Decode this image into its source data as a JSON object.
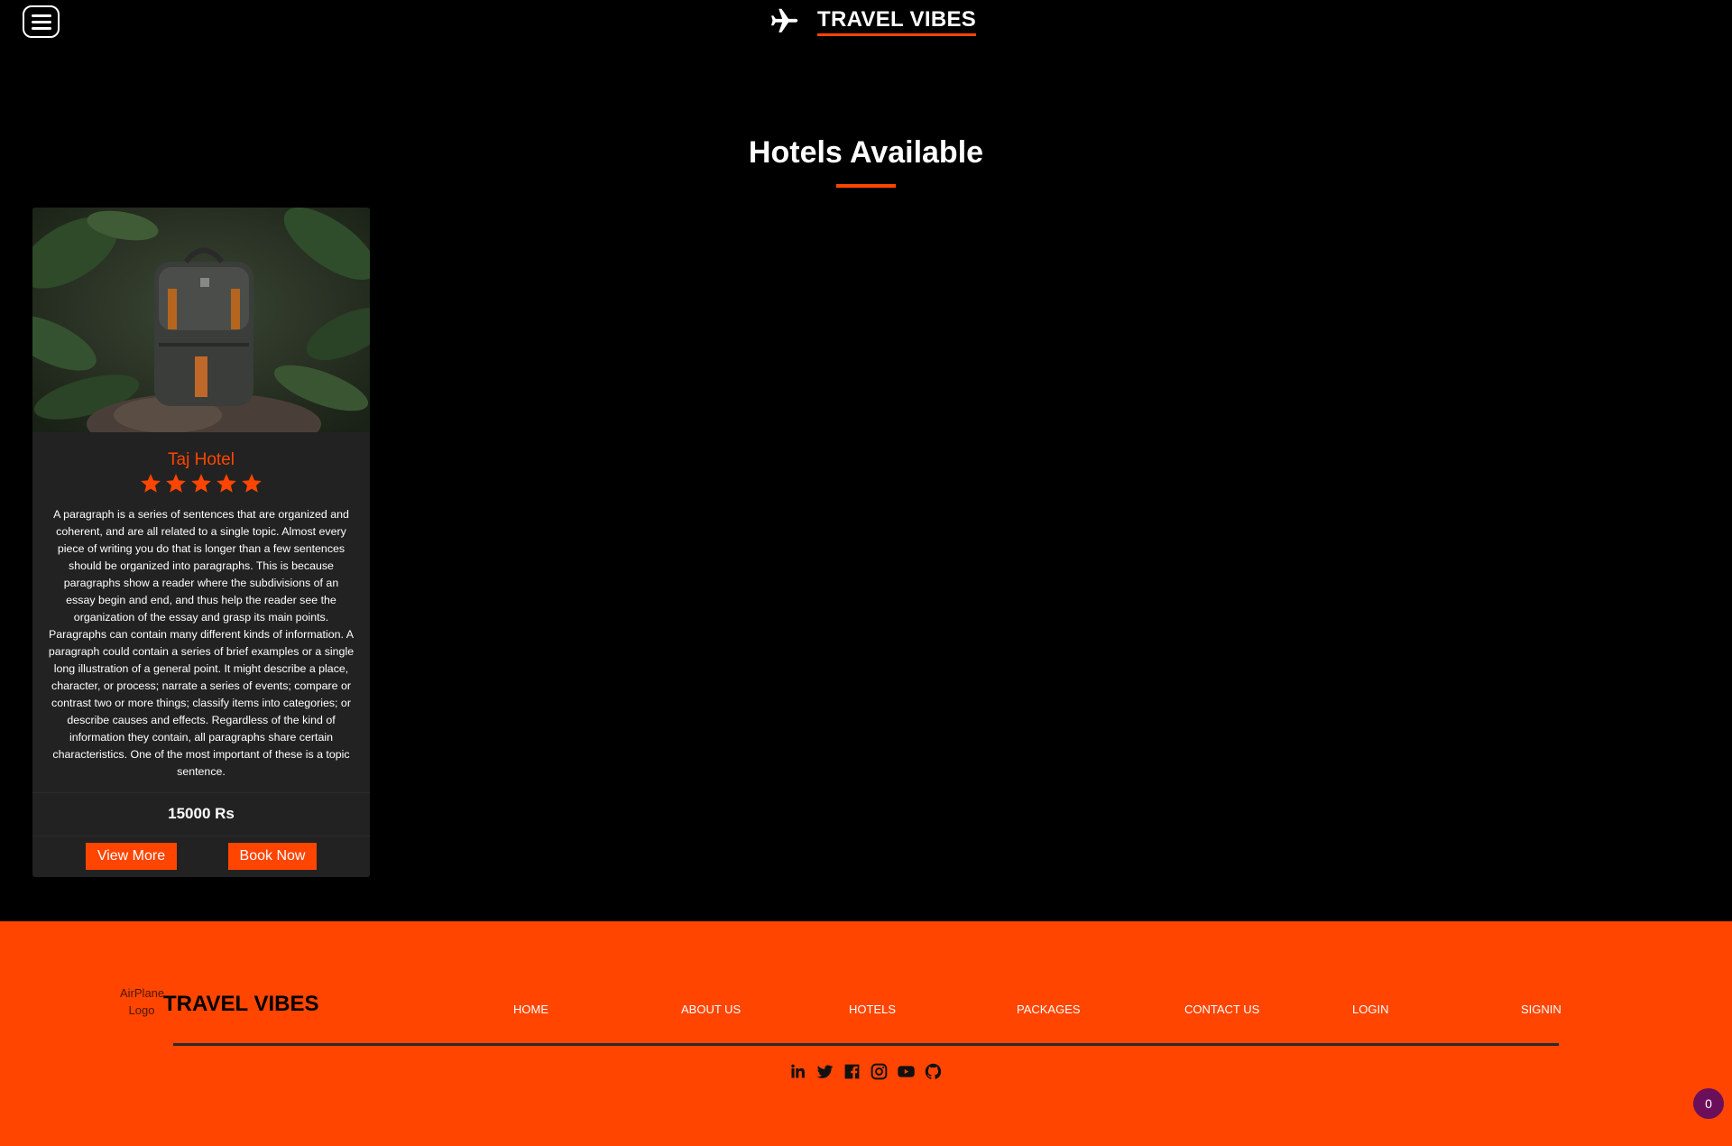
{
  "header": {
    "brand": "TRAVEL VIBES",
    "menu_icon": "hamburger-menu-icon",
    "logo_icon": "airplane-icon"
  },
  "main": {
    "section_title": "Hotels Available"
  },
  "hotels": [
    {
      "name": "Taj Hotel",
      "rating": 5,
      "rating_max": 5,
      "image_subject": "backpack",
      "description": "A paragraph is a series of sentences that are organized and coherent, and are all related to a single topic. Almost every piece of writing you do that is longer than a few sentences should be organized into paragraphs. This is because paragraphs show a reader where the subdivisions of an essay begin and end, and thus help the reader see the organization of the essay and grasp its main points. Paragraphs can contain many different kinds of information. A paragraph could contain a series of brief examples or a single long illustration of a general point. It might describe a place, character, or process; narrate a series of events; compare or contrast two or more things; classify items into categories; or describe causes and effects. Regardless of the kind of information they contain, all paragraphs share certain characteristics. One of the most important of these is a topic sentence.",
      "price": "15000 Rs",
      "view_more_label": "View More",
      "book_now_label": "Book Now"
    }
  ],
  "footer": {
    "logo_alt": "AirPlane Logo",
    "brand": "TRAVEL VIBES",
    "nav": [
      "HOME",
      "ABOUT US",
      "HOTELS",
      "PACKAGES",
      "CONTACT US",
      "LOGIN",
      "SIGNIN"
    ],
    "social_icons": [
      "linkedin-icon",
      "twitter-icon",
      "facebook-icon",
      "instagram-icon",
      "youtube-icon",
      "github-icon"
    ]
  },
  "widget": {
    "count": "0"
  },
  "colors": {
    "accent": "#ff4500",
    "background": "#000000",
    "card": "#222222",
    "widget": "#6b0f5a"
  }
}
